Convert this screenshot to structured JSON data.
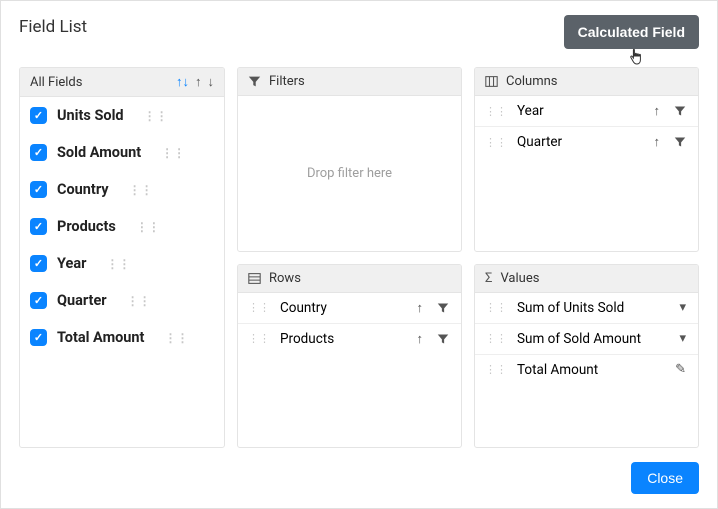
{
  "title": "Field List",
  "calculated_field_label": "Calculated Field",
  "close_label": "Close",
  "all_fields": {
    "header": "All Fields",
    "items": [
      {
        "label": "Units Sold"
      },
      {
        "label": "Sold Amount"
      },
      {
        "label": "Country"
      },
      {
        "label": "Products"
      },
      {
        "label": "Year"
      },
      {
        "label": "Quarter"
      },
      {
        "label": "Total Amount"
      }
    ]
  },
  "filters": {
    "header": "Filters",
    "drop_hint": "Drop filter here"
  },
  "columns": {
    "header": "Columns",
    "items": [
      {
        "label": "Year"
      },
      {
        "label": "Quarter"
      }
    ]
  },
  "rows": {
    "header": "Rows",
    "items": [
      {
        "label": "Country"
      },
      {
        "label": "Products"
      }
    ]
  },
  "values": {
    "header": "Values",
    "items": [
      {
        "label": "Sum of Units Sold",
        "action": "dropdown"
      },
      {
        "label": "Sum of Sold Amount",
        "action": "dropdown"
      },
      {
        "label": "Total Amount",
        "action": "edit"
      }
    ]
  }
}
